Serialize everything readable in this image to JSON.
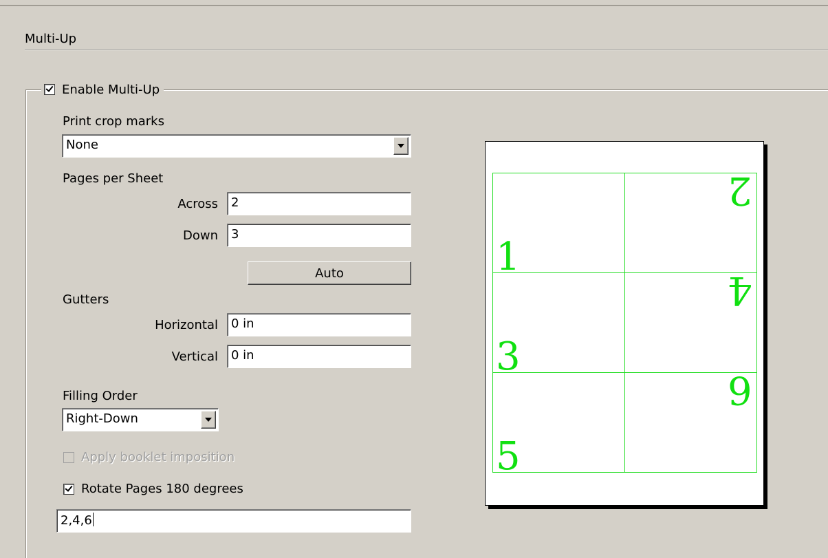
{
  "section": {
    "title": "Multi-Up"
  },
  "enable_multiup": {
    "label": "Enable Multi-Up",
    "checked": true
  },
  "crop_marks": {
    "label": "Print crop marks",
    "value": "None"
  },
  "pages_per_sheet": {
    "label": "Pages per Sheet",
    "across_label": "Across",
    "across_value": "2",
    "down_label": "Down",
    "down_value": "3",
    "auto_label": "Auto"
  },
  "gutters": {
    "label": "Gutters",
    "horizontal_label": "Horizontal",
    "horizontal_value": "0 in",
    "vertical_label": "Vertical",
    "vertical_value": "0 in"
  },
  "filling_order": {
    "label": "Filling Order",
    "value": "Right-Down"
  },
  "booklet": {
    "label": "Apply booklet imposition",
    "checked": false,
    "disabled": true
  },
  "rotate": {
    "label": "Rotate Pages 180 degrees",
    "checked": true,
    "pages_value": "2,4,6"
  },
  "preview": {
    "cells": [
      {
        "label": "1",
        "rotated": false
      },
      {
        "label": "2",
        "rotated": true
      },
      {
        "label": "3",
        "rotated": false
      },
      {
        "label": "4",
        "rotated": true
      },
      {
        "label": "5",
        "rotated": false
      },
      {
        "label": "6",
        "rotated": true
      }
    ],
    "grid_color": "#22dd22"
  }
}
